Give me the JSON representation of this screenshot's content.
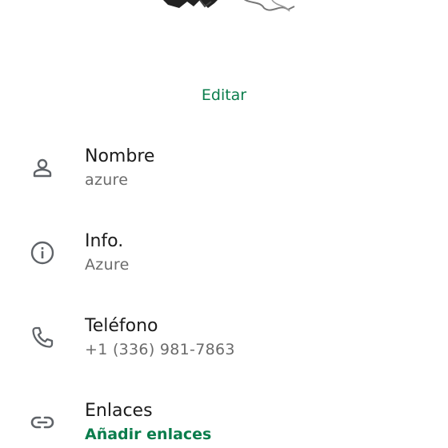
{
  "profile": {
    "edit_label": "Editar"
  },
  "fields": [
    {
      "icon": "person-icon",
      "label": "Nombre",
      "value": "azure"
    },
    {
      "icon": "info-icon",
      "label": "Info.",
      "value": "Azure"
    },
    {
      "icon": "phone-icon",
      "label": "Teléfono",
      "value": "+1 (336) 981-7863"
    },
    {
      "icon": "link-icon",
      "label": "Enlaces",
      "value": "Añadir enlaces"
    }
  ],
  "colors": {
    "accent": "#0a7d4c",
    "icon": "#5f6368",
    "label": "#1b1b1b",
    "secondary": "#6b6b6b"
  }
}
